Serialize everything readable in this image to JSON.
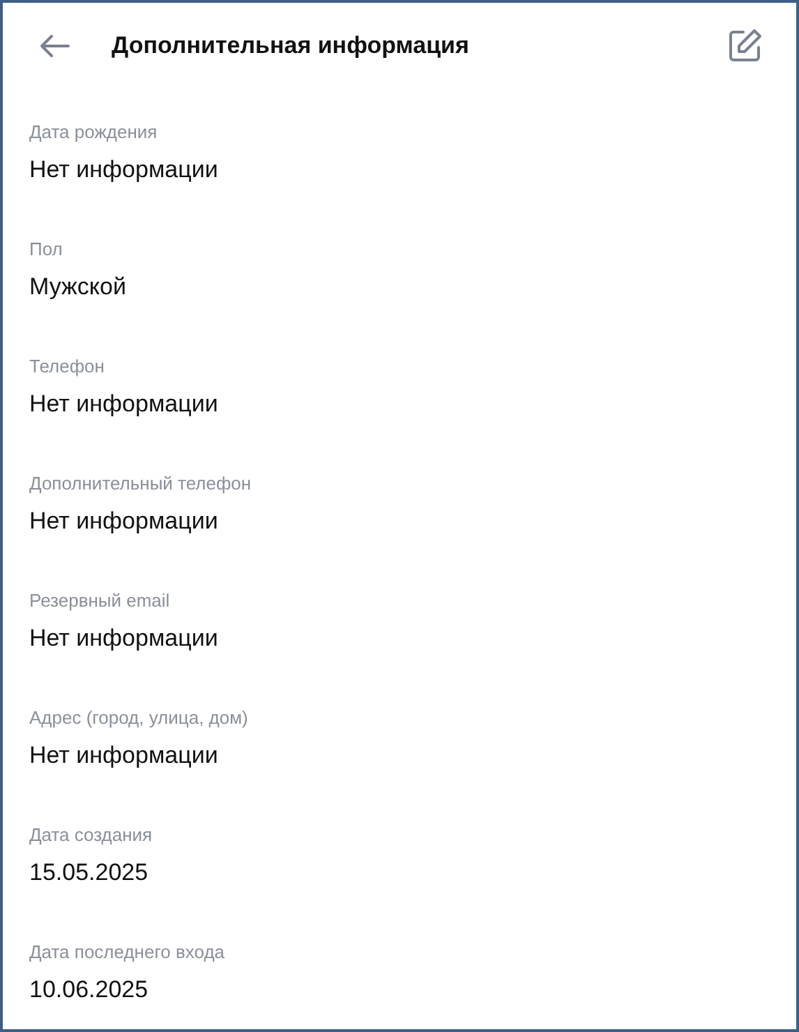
{
  "header": {
    "title": "Дополнительная информация"
  },
  "fields": [
    {
      "label": "Дата рождения",
      "value": "Нет информации"
    },
    {
      "label": "Пол",
      "value": "Мужской"
    },
    {
      "label": "Телефон",
      "value": "Нет информации"
    },
    {
      "label": "Дополнительный телефон",
      "value": "Нет информации"
    },
    {
      "label": "Резервный email",
      "value": "Нет информации"
    },
    {
      "label": "Адрес (город, улица, дом)",
      "value": "Нет информации"
    },
    {
      "label": "Дата создания",
      "value": "15.05.2025"
    },
    {
      "label": "Дата последнего входа",
      "value": "10.06.2025"
    }
  ]
}
